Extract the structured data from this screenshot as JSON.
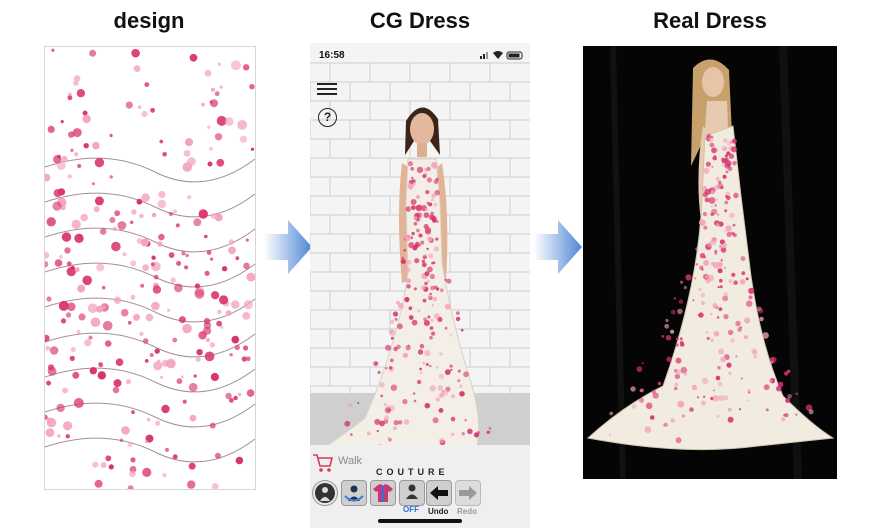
{
  "titles": {
    "design": "design",
    "cg_dress": "CG Dress",
    "real_dress": "Real Dress"
  },
  "phone": {
    "status_time": "16:58",
    "walk_label": "Walk",
    "couture_label": "COUTURE",
    "off_label": "OFF",
    "undo_label": "Undo",
    "redo_label": "Redo",
    "help_glyph": "?"
  },
  "colors": {
    "blossom": "#d8336e",
    "blossom_light": "#f4a3bd",
    "branch": "#6b4a3a",
    "dress_white": "#f3efe6",
    "arrow_blue": "#5b8fd8",
    "photo_bg": "#050505"
  },
  "icons": [
    "menu-icon",
    "help-icon",
    "cart-icon",
    "avatar-icon",
    "rotate-icon",
    "shirt-icon",
    "wear-off-icon",
    "undo-arrow-icon",
    "redo-arrow-icon",
    "signal-icon",
    "wifi-icon",
    "battery-icon",
    "right-arrow-icon"
  ]
}
